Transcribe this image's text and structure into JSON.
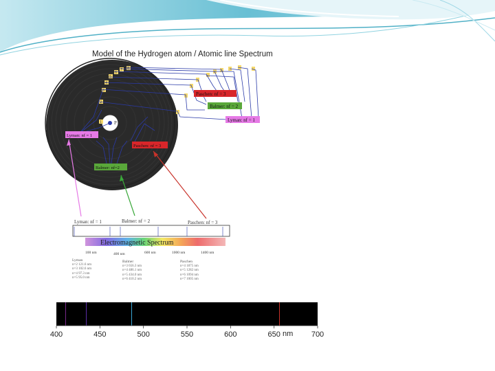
{
  "title": "Model of the Hydrogen atom / Atomic line Spectrum",
  "nucleus_label": "P",
  "orbit_labels": [
    "1",
    "2",
    "3",
    "4",
    "5",
    "6",
    "7",
    "8",
    "9"
  ],
  "series_labels": {
    "paschen": "Paschen: nf = 3",
    "balmer": "Balmer: nf = 2",
    "lyman": "Lyman: nf = 1",
    "lyman_inner": "Lyman: nf = 1",
    "paschen_inner": "Paschen: nf = 3",
    "balmer_inner": "Balmer: nf=2"
  },
  "spectrum_box": {
    "lyman": "Lyman: nf = 1",
    "balmer": "Balmer: nf = 2",
    "paschen": "Paschen: nf = 3",
    "title": "Electromagnetic Spectrum",
    "ticks": [
      "100 nm",
      "400 nm",
      "600 nm",
      "1000 nm",
      "1400 nm"
    ]
  },
  "series_tables": {
    "lyman": {
      "head": "Lyman",
      "rows": [
        "n=2  121.6 nm",
        "n=3  102.6 nm",
        "n=4  97.3 nm",
        "n=5  95.0 nm"
      ]
    },
    "balmer": {
      "head": "Balmer",
      "rows": [
        "n=3  656.3 nm",
        "n=4  486.1 nm",
        "n=5  434.0 nm",
        "n=6  410.2 nm"
      ]
    },
    "paschen": {
      "head": "Paschen",
      "rows": [
        "n=4  1875 nm",
        "n=5  1282 nm",
        "n=6  1094 nm",
        "n=7  1005 nm"
      ]
    }
  },
  "emission_spectrum": {
    "unit": "nm",
    "tick_labels": [
      "400",
      "450",
      "500",
      "550",
      "600",
      "650",
      "700"
    ],
    "lines": [
      {
        "wavelength": 410,
        "color": "#7a2a8c"
      },
      {
        "wavelength": 434,
        "color": "#5b2ea6"
      },
      {
        "wavelength": 486,
        "color": "#3aa8d8"
      },
      {
        "wavelength": 656,
        "color": "#c8322a"
      }
    ]
  },
  "colors": {
    "paschen": "#d8262a",
    "balmer": "#5aa83a",
    "lyman": "#e67ae6",
    "accent_teal": "#6cc6d8"
  }
}
